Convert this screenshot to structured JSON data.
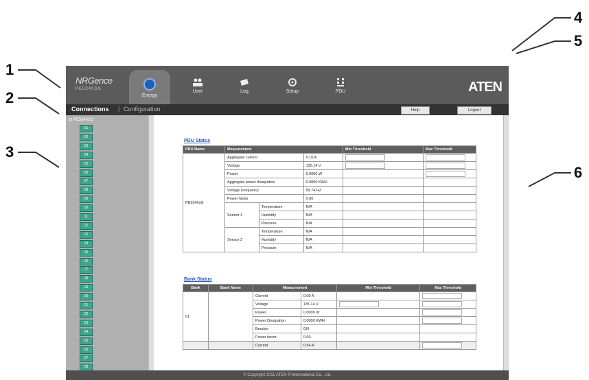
{
  "callouts": [
    "1",
    "2",
    "3",
    "4",
    "5",
    "6"
  ],
  "brand": {
    "name": "NRGence",
    "model": "PE5340SG"
  },
  "nav": [
    {
      "label": "Energy",
      "icon": "energy-icon",
      "active": true
    },
    {
      "label": "User",
      "icon": "user-icon"
    },
    {
      "label": "Log",
      "icon": "log-icon"
    },
    {
      "label": "Setup",
      "icon": "setup-icon"
    },
    {
      "label": "PDU",
      "icon": "pdu-icon"
    }
  ],
  "logo": "ATEN",
  "subnav": {
    "connections": "Connections",
    "separator": "|",
    "configuration": "Configuration",
    "help": "Help",
    "logout": "Logout"
  },
  "sidebar": {
    "root": "PE5340SG",
    "outlets": [
      "01",
      "02",
      "03",
      "04",
      "05",
      "06",
      "07",
      "08",
      "09",
      "10",
      "11",
      "12",
      "13",
      "14",
      "15",
      "16",
      "17",
      "18",
      "19",
      "20",
      "21",
      "22",
      "23",
      "24",
      "25",
      "26",
      "27",
      "28"
    ]
  },
  "pdu_status": {
    "title": "PDU Status",
    "headers": [
      "PDU Name",
      "Measurement",
      "Min Threshold",
      "Max Threshold"
    ],
    "pdu_name": "PE5340sG",
    "rows": [
      {
        "label": "Aggregate current",
        "value": "0.10 A"
      },
      {
        "label": "Voltage",
        "value": "135.14 V"
      },
      {
        "label": "Power",
        "value": "0.0000 W"
      },
      {
        "label": "Aggregate power dissipation",
        "value": "0.0000 KWH"
      },
      {
        "label": "Voltage Frequency",
        "value": "59.74 HZ"
      },
      {
        "label": "Power factor",
        "value": "0.00"
      }
    ],
    "sensors": [
      {
        "name": "Sensor 1",
        "rows": [
          {
            "label": "Temperature",
            "value": "N/A"
          },
          {
            "label": "Humidity",
            "value": "N/A"
          },
          {
            "label": "Pressure",
            "value": "N/A"
          }
        ]
      },
      {
        "name": "Sensor 2",
        "rows": [
          {
            "label": "Temperature",
            "value": "N/A"
          },
          {
            "label": "Humidity",
            "value": "N/A"
          },
          {
            "label": "Pressure",
            "value": "N/A"
          }
        ]
      }
    ]
  },
  "bank_status": {
    "title": "Bank Status",
    "headers": [
      "Bank",
      "Bank Name",
      "Measurement",
      "Min Threshold",
      "Max Threshold"
    ],
    "bank": "01",
    "rows": [
      {
        "label": "Current",
        "value": "0.00 A"
      },
      {
        "label": "Voltage",
        "value": "135.14 V"
      },
      {
        "label": "Power",
        "value": "0.0000 W"
      },
      {
        "label": "Power Dissipation",
        "value": "0.0000 KWH"
      },
      {
        "label": "Breaker",
        "value": "ON"
      },
      {
        "label": "Power factor",
        "value": "0.00"
      },
      {
        "label": "Current",
        "value": "0.54 A"
      }
    ]
  },
  "footer": "© Copyright 2011 ATEN ® International Co., Ltd."
}
